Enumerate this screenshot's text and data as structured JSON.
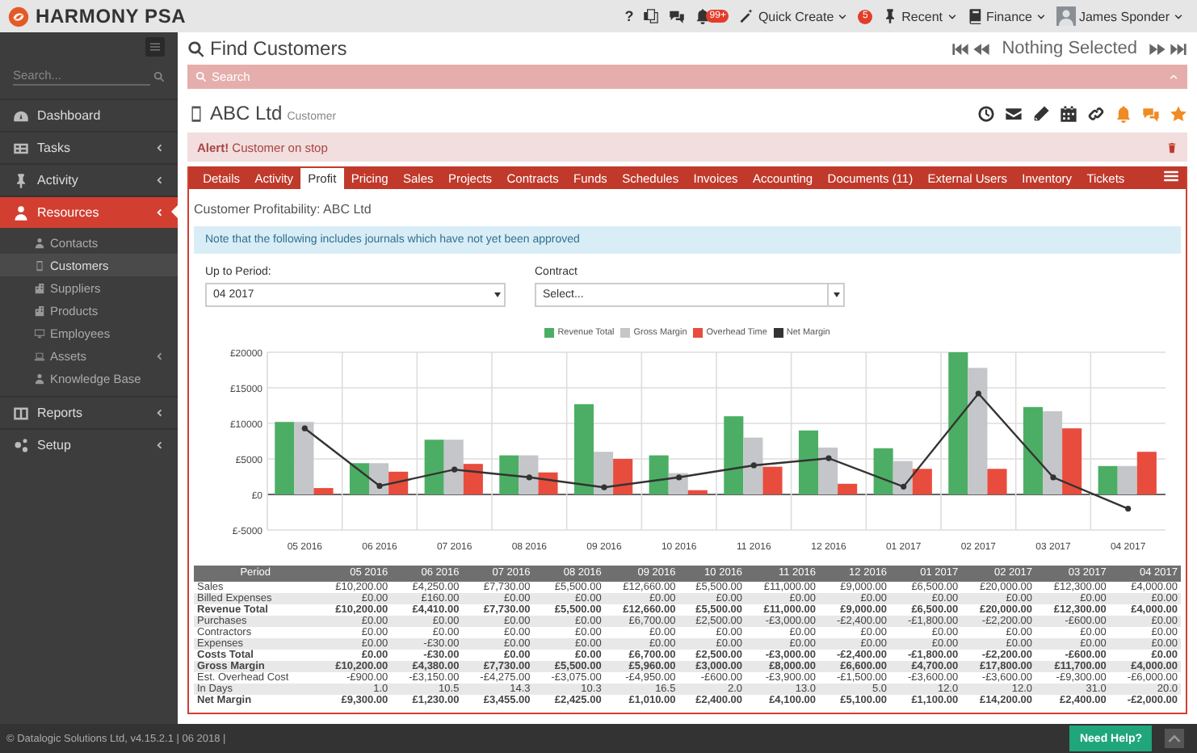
{
  "app": {
    "name": "HARMONY PSA"
  },
  "topbar": {
    "help": "?",
    "notifications_badge": "99+",
    "quick_create": "Quick Create",
    "recent_badge": "5",
    "recent": "Recent",
    "finance": "Finance",
    "user": "James Sponder"
  },
  "sidebar": {
    "search_placeholder": "Search...",
    "items": [
      {
        "label": "Dashboard",
        "selected": false,
        "has_submenu": false
      },
      {
        "label": "Tasks",
        "selected": false,
        "has_submenu": true
      },
      {
        "label": "Activity",
        "selected": false,
        "has_submenu": true
      },
      {
        "label": "Resources",
        "selected": true,
        "has_submenu": true,
        "children": [
          {
            "label": "Contacts",
            "selected": false,
            "has_submenu": false
          },
          {
            "label": "Customers",
            "selected": true,
            "has_submenu": false
          },
          {
            "label": "Suppliers",
            "selected": false,
            "has_submenu": false
          },
          {
            "label": "Products",
            "selected": false,
            "has_submenu": false
          },
          {
            "label": "Employees",
            "selected": false,
            "has_submenu": false
          },
          {
            "label": "Assets",
            "selected": false,
            "has_submenu": true
          },
          {
            "label": "Knowledge Base",
            "selected": false,
            "has_submenu": false
          }
        ]
      },
      {
        "label": "Reports",
        "selected": false,
        "has_submenu": true
      },
      {
        "label": "Setup",
        "selected": false,
        "has_submenu": true
      }
    ]
  },
  "page": {
    "title": "Find Customers",
    "search_label": "Search",
    "selection": "Nothing Selected"
  },
  "record": {
    "name": "ABC Ltd",
    "type": "Customer",
    "alert": "**Alert!** Customer on stop"
  },
  "tabs": [
    {
      "label": "Details",
      "selected": false
    },
    {
      "label": "Activity",
      "selected": false
    },
    {
      "label": "Profit",
      "selected": true
    },
    {
      "label": "Pricing",
      "selected": false
    },
    {
      "label": "Sales",
      "selected": false
    },
    {
      "label": "Projects",
      "selected": false
    },
    {
      "label": "Contracts",
      "selected": false
    },
    {
      "label": "Funds",
      "selected": false
    },
    {
      "label": "Schedules",
      "selected": false
    },
    {
      "label": "Invoices",
      "selected": false
    },
    {
      "label": "Accounting",
      "selected": false
    },
    {
      "label": "Documents (11)",
      "selected": false
    },
    {
      "label": "External Users",
      "selected": false
    },
    {
      "label": "Inventory",
      "selected": false
    },
    {
      "label": "Tickets",
      "selected": false
    }
  ],
  "profit": {
    "title": "Customer Profitability: ABC Ltd",
    "note": "Note that the following includes journals which have not yet been approved",
    "filters": [
      {
        "label": "Up to Period:",
        "value": "04 2017"
      },
      {
        "label": "Contract",
        "value": "Select..."
      }
    ],
    "chart_data": {
      "type": "bar",
      "categories": [
        "05 2016",
        "06 2016",
        "07 2016",
        "08 2016",
        "09 2016",
        "10 2016",
        "11 2016",
        "12 2016",
        "01 2017",
        "02 2017",
        "03 2017",
        "04 2017"
      ],
      "stacked": false,
      "grid": true,
      "series": [
        {
          "name": "Revenue Total",
          "type": "bar",
          "color": "#4cae64",
          "values": [
            10200,
            4400,
            7700,
            5500,
            12700,
            5500,
            11000,
            9000,
            6500,
            20000,
            12300,
            4000
          ]
        },
        {
          "name": "Gross Margin",
          "type": "bar",
          "color": "#c4c6c9",
          "values": [
            10200,
            4400,
            7700,
            5500,
            6000,
            3000,
            8000,
            6600,
            4700,
            17800,
            11700,
            4000
          ]
        },
        {
          "name": "Overhead Time",
          "type": "bar",
          "color": "#e84c3d",
          "values": [
            900,
            3200,
            4300,
            3100,
            5000,
            600,
            3900,
            1500,
            3600,
            3600,
            9300,
            6000
          ]
        },
        {
          "name": "Net Margin",
          "type": "line",
          "marker": "circle",
          "color": "#333333",
          "values": [
            9300,
            1200,
            3500,
            2400,
            1000,
            2400,
            4100,
            5100,
            1100,
            14200,
            2400,
            -2000
          ]
        }
      ],
      "ylim": [
        -5000,
        20000
      ],
      "yticks": [
        {
          "value": 20000,
          "label": "£20000"
        },
        {
          "value": 15000,
          "label": "£15000"
        },
        {
          "value": 10000,
          "label": "£10000"
        },
        {
          "value": 5000,
          "label": "£5000"
        },
        {
          "value": 0,
          "label": "£0"
        },
        {
          "value": -5000,
          "label": "£-5000"
        }
      ]
    },
    "table": {
      "columns": [
        "Period",
        "05 2016",
        "06 2016",
        "07 2016",
        "08 2016",
        "09 2016",
        "10 2016",
        "11 2016",
        "12 2016",
        "01 2017",
        "02 2017",
        "03 2017",
        "04 2017"
      ],
      "rows": [
        {
          "label": "Sales",
          "emphasis": false,
          "values": [
            "£10,200.00",
            "£4,250.00",
            "£7,730.00",
            "£5,500.00",
            "£12,660.00",
            "£5,500.00",
            "£11,000.00",
            "£9,000.00",
            "£6,500.00",
            "£20,000.00",
            "£12,300.00",
            "£4,000.00"
          ]
        },
        {
          "label": "Billed Expenses",
          "emphasis": false,
          "values": [
            "£0.00",
            "£160.00",
            "£0.00",
            "£0.00",
            "£0.00",
            "£0.00",
            "£0.00",
            "£0.00",
            "£0.00",
            "£0.00",
            "£0.00",
            "£0.00"
          ]
        },
        {
          "label": "Revenue Total",
          "emphasis": true,
          "values": [
            "£10,200.00",
            "£4,410.00",
            "£7,730.00",
            "£5,500.00",
            "£12,660.00",
            "£5,500.00",
            "£11,000.00",
            "£9,000.00",
            "£6,500.00",
            "£20,000.00",
            "£12,300.00",
            "£4,000.00"
          ]
        },
        {
          "label": "Purchases",
          "emphasis": false,
          "values": [
            "£0.00",
            "£0.00",
            "£0.00",
            "£0.00",
            "£6,700.00",
            "£2,500.00",
            "-£3,000.00",
            "-£2,400.00",
            "-£1,800.00",
            "-£2,200.00",
            "-£600.00",
            "£0.00"
          ]
        },
        {
          "label": "Contractors",
          "emphasis": false,
          "values": [
            "£0.00",
            "£0.00",
            "£0.00",
            "£0.00",
            "£0.00",
            "£0.00",
            "£0.00",
            "£0.00",
            "£0.00",
            "£0.00",
            "£0.00",
            "£0.00"
          ]
        },
        {
          "label": "Expenses",
          "emphasis": false,
          "values": [
            "£0.00",
            "-£30.00",
            "£0.00",
            "£0.00",
            "£0.00",
            "£0.00",
            "£0.00",
            "£0.00",
            "£0.00",
            "£0.00",
            "£0.00",
            "£0.00"
          ]
        },
        {
          "label": "Costs Total",
          "emphasis": true,
          "values": [
            "£0.00",
            "-£30.00",
            "£0.00",
            "£0.00",
            "£6,700.00",
            "£2,500.00",
            "-£3,000.00",
            "-£2,400.00",
            "-£1,800.00",
            "-£2,200.00",
            "-£600.00",
            "£0.00"
          ]
        },
        {
          "label": "Gross Margin",
          "emphasis": true,
          "values": [
            "£10,200.00",
            "£4,380.00",
            "£7,730.00",
            "£5,500.00",
            "£5,960.00",
            "£3,000.00",
            "£8,000.00",
            "£6,600.00",
            "£4,700.00",
            "£17,800.00",
            "£11,700.00",
            "£4,000.00"
          ]
        },
        {
          "label": "Est. Overhead Cost",
          "emphasis": false,
          "values": [
            "-£900.00",
            "-£3,150.00",
            "-£4,275.00",
            "-£3,075.00",
            "-£4,950.00",
            "-£600.00",
            "-£3,900.00",
            "-£1,500.00",
            "-£3,600.00",
            "-£3,600.00",
            "-£9,300.00",
            "-£6,000.00"
          ]
        },
        {
          "label": "In Days",
          "emphasis": false,
          "values": [
            "1.0",
            "10.5",
            "14.3",
            "10.3",
            "16.5",
            "2.0",
            "13.0",
            "5.0",
            "12.0",
            "12.0",
            "31.0",
            "20.0"
          ]
        },
        {
          "label": "Net Margin",
          "emphasis": true,
          "values": [
            "£9,300.00",
            "£1,230.00",
            "£3,455.00",
            "£2,425.00",
            "£1,010.00",
            "£2,400.00",
            "£4,100.00",
            "£5,100.00",
            "£1,100.00",
            "£14,200.00",
            "£2,400.00",
            "-£2,000.00"
          ]
        }
      ]
    }
  },
  "footer": {
    "text": "© Datalogic Solutions Ltd, v4.15.2.1 | 06 2018 |",
    "help_button": "Need Help?"
  }
}
